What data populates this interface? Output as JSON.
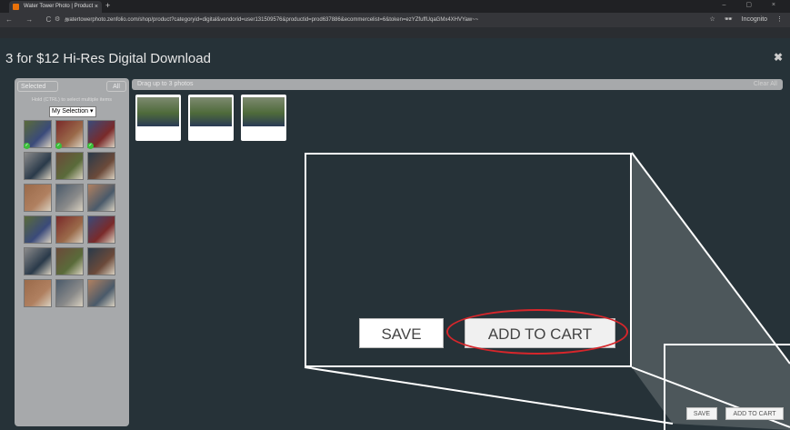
{
  "browser": {
    "tab_title": "Water Tower Photo | Product",
    "tab_close": "×",
    "new_tab": "+",
    "window_controls": "– ▢ ×",
    "nav_icons": "← → C ⌂",
    "url": "watertowerphoto.zenfolio.com/shop/product?categoryid=digital&vendorid=user131509576&productid=prod637886&ecommercelist=6&token=ezYZfuffUqaGMx4XHVYaw~~",
    "incognito_label": "Incognito",
    "accent_color": "#e8710a"
  },
  "modal": {
    "title": "3 for $12 Hi-Res Digital Download",
    "close_icon": "✖",
    "left_panel": {
      "tab_selected": "Selected",
      "tab_all": "All",
      "hint": "Hold (CTRL) to select multiple items",
      "dropdown_value": "My Selection",
      "thumbnail_count": 18,
      "checked_count": 3
    },
    "drop_bar_text": "Drag up to 3 photos",
    "drop_bar_right": "Clear All",
    "picked_count": 3
  },
  "callout": {
    "save_label": "SAVE",
    "add_to_cart_label": "ADD TO CART",
    "highlight_color": "#d6262b"
  },
  "footer": {
    "save_label": "SAVE",
    "add_to_cart_label": "ADD TO CART"
  }
}
